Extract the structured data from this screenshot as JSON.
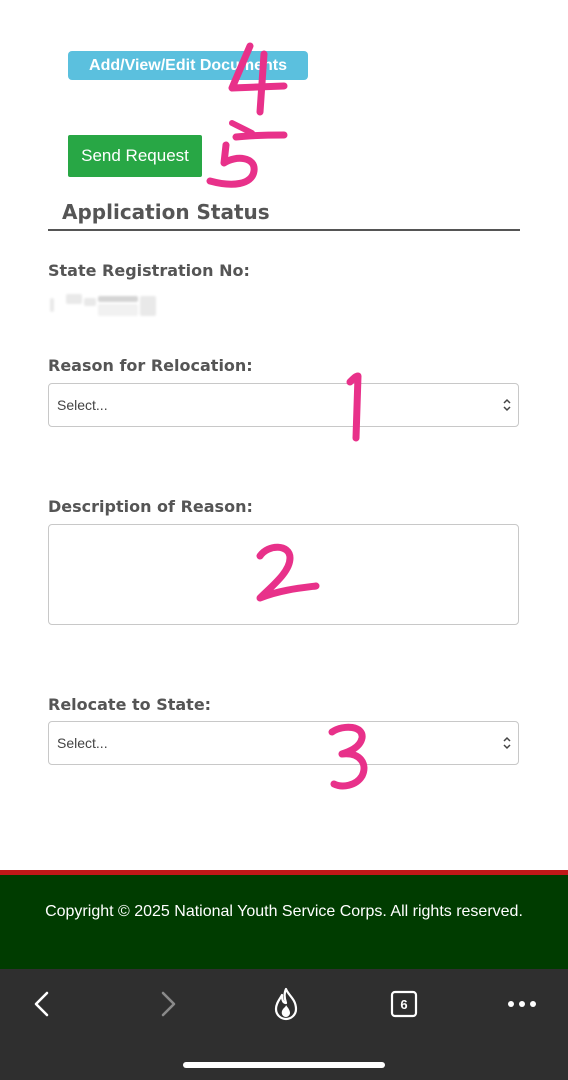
{
  "toolbar": {
    "docs_label": "Add/View/Edit Documents",
    "send_label": "Send Request"
  },
  "section": {
    "title": "Application Status"
  },
  "form": {
    "reg_label": "State Registration No:",
    "reason_label": "Reason for Relocation:",
    "reason_select_value": "Select...",
    "description_label": "Description of Reason:",
    "description_value": "",
    "state_label": "Relocate to State:",
    "state_select_value": "Select..."
  },
  "annotations": [
    "4",
    "5",
    "1",
    "2",
    "3"
  ],
  "footer": {
    "copyright": "Copyright © 2025 National Youth Service Corps. All rights reserved."
  },
  "browser": {
    "tab_count": "6"
  },
  "colors": {
    "docs_button": "#5bc0de",
    "send_button": "#28a745",
    "footer_bg": "#003c00",
    "footer_accent": "#c01818",
    "annotation_ink": "#e8318a",
    "browser_bar": "#2f2f2f"
  },
  "icons": [
    "back-icon",
    "forward-icon",
    "flame-icon",
    "tabs-icon",
    "more-icon",
    "select-caret-icon"
  ]
}
